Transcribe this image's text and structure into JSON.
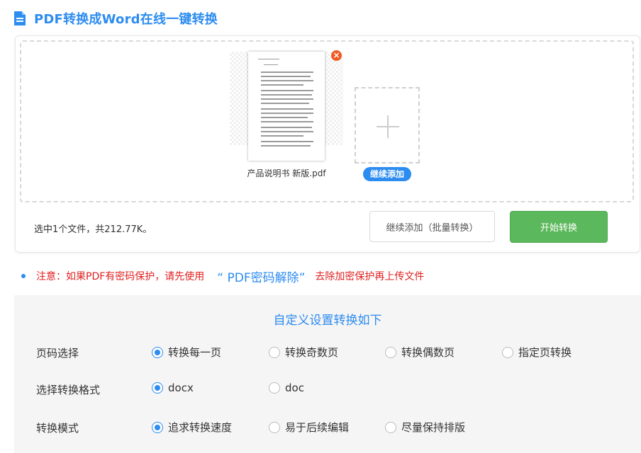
{
  "header": {
    "title": "PDF转换成Word在线一键转换"
  },
  "upload": {
    "file": {
      "name": "产品说明书 新版.pdf",
      "remove_glyph": "×"
    },
    "add_badge": "继续添加",
    "summary": "选中1个文件，共212.77K。",
    "batch_button": "继续添加（批量转换）",
    "start_button": "开始转换"
  },
  "notice": {
    "prefix": "注意：如果PDF有密码保护，请先使用",
    "link": "“ PDF密码解除”",
    "suffix": "去除加密保护再上传文件"
  },
  "settings": {
    "title": "自定义设置转换如下",
    "rows": [
      {
        "label": "页码选择",
        "options": [
          {
            "label": "转换每一页",
            "checked": true
          },
          {
            "label": "转换奇数页",
            "checked": false
          },
          {
            "label": "转换偶数页",
            "checked": false
          },
          {
            "label": "指定页转换",
            "checked": false
          }
        ]
      },
      {
        "label": "选择转换格式",
        "options": [
          {
            "label": "docx",
            "checked": true
          },
          {
            "label": "doc",
            "checked": false
          }
        ]
      },
      {
        "label": "转换模式",
        "options": [
          {
            "label": "追求转换速度",
            "checked": true
          },
          {
            "label": "易于后续编辑",
            "checked": false
          },
          {
            "label": "尽量保持排版",
            "checked": false
          }
        ]
      }
    ]
  },
  "colors": {
    "accent": "#2d8cf0",
    "start_button": "#5cb85c",
    "notice_text": "#e02020",
    "remove_badge": "#f05a23"
  },
  "icons": [
    "document-icon",
    "close-icon",
    "plus-icon",
    "bullet-icon",
    "radio-icon"
  ]
}
